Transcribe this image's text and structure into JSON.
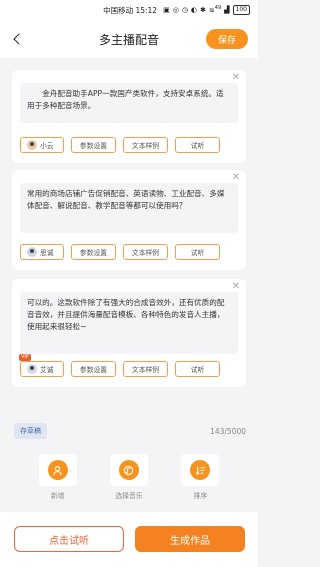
{
  "status_bar": {
    "carrier_time": "中国移动 15:12",
    "icons": [
      "notification-icon",
      "wechat-icon",
      "alarm-icon",
      "silent-icon",
      "bluetooth-icon",
      "wifi-icon",
      "signal-icon"
    ],
    "wifi": "49",
    "battery": "100"
  },
  "header": {
    "title": "多主播配音",
    "save_label": "保存"
  },
  "segments": [
    {
      "text": "　　金舟配音助手APP一款国产类软件，支持安卓系统。适用于多种配音场景。",
      "voice": "小云",
      "vip": "",
      "params_label": "参数设置",
      "sample_label": "文本样例",
      "listen_label": "试听"
    },
    {
      "text": "常用的商场店铺广告促销配音、英语读物、工业配音、多媒体配音、解说配音、教学配音等都可以使用吗？",
      "voice": "思诚",
      "vip": "",
      "params_label": "参数设置",
      "sample_label": "文本样例",
      "listen_label": "试听"
    },
    {
      "text": "可以的。这款软件除了有强大的合成音效外，还有优质的配音音效，并且提供海量配音模板、各种特色的发音人主播，使用起来很轻松~",
      "voice": "艾诚",
      "vip": "VIP",
      "params_label": "参数设置",
      "sample_label": "文本样例",
      "listen_label": "试听"
    }
  ],
  "draft": {
    "label": "存草稿",
    "count": "143/5000"
  },
  "tools": [
    {
      "label": "新增",
      "icon": "add-user-icon"
    },
    {
      "label": "选择音乐",
      "icon": "music-icon"
    },
    {
      "label": "排序",
      "icon": "sort-icon"
    }
  ],
  "footer": {
    "try_label": "点击试听",
    "generate_label": "生成作品"
  },
  "colors": {
    "accent": "#f7931e",
    "accent_dark": "#e0632f",
    "vip": "#e95f2d",
    "draft_text": "#4a6fa5"
  }
}
